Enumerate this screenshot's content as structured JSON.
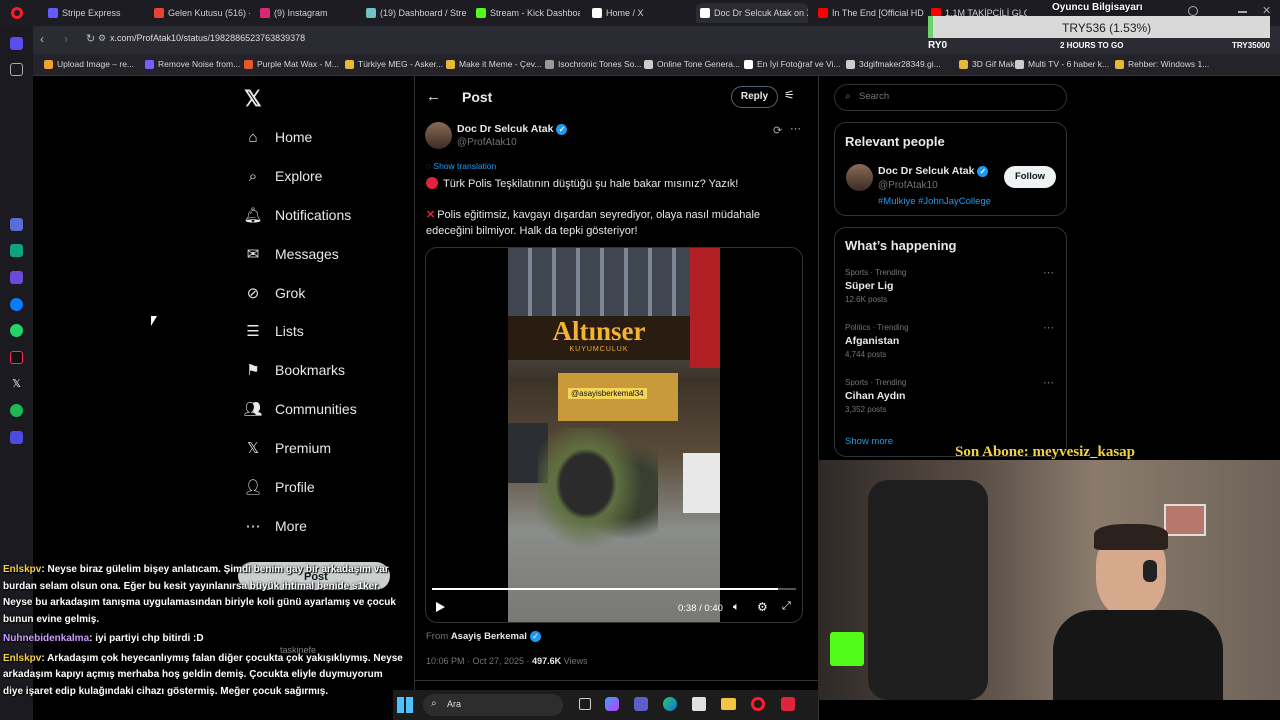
{
  "tabs": [
    {
      "label": "Stripe Express",
      "color": "#635bff"
    },
    {
      "label": "Gelen Kutusu (516) - no",
      "color": "#ea4335"
    },
    {
      "label": "(9) Instagram",
      "color": "#d62976"
    },
    {
      "label": "(19) Dashboard / Stream",
      "color": "#6fc3c3"
    },
    {
      "label": "Stream - Kick Dashboar",
      "color": "#53fc18"
    },
    {
      "label": "Home / X",
      "color": "#ffffff"
    },
    {
      "label": "Doc Dr Selcuk Atak on X:",
      "color": "#ffffff"
    },
    {
      "label": "In The End [Official HD",
      "color": "#ff0000"
    },
    {
      "label": "1.1M TAKİPÇİLİ GLOBAL",
      "color": "#ff0000"
    }
  ],
  "browser": {
    "url": "x.com/ProfAtak10/status/1982886523763839378"
  },
  "bookmarks": [
    {
      "label": "Upload Image – re...",
      "color": "#f0a030"
    },
    {
      "label": "Remove Noise from...",
      "color": "#7b5cff"
    },
    {
      "label": "Purple Mat Wax - M...",
      "color": "#e8562b"
    },
    {
      "label": "Türkiye MEG - Asker...",
      "color": "#e7b83a"
    },
    {
      "label": "Make it Meme - Çev...",
      "color": "#e7b83a"
    },
    {
      "label": "Isochronic Tones So...",
      "color": "#999999"
    },
    {
      "label": "Online Tone Genera...",
      "color": "#cccccc"
    },
    {
      "label": "En İyi Fotoğraf ve Vi...",
      "color": "#ffffff"
    },
    {
      "label": "3dgifmaker28349.gi...",
      "color": "#cccccc"
    },
    {
      "label": "3D Gif Maker",
      "color": "#e7b83a"
    },
    {
      "label": "Multi TV - 6 haber k...",
      "color": "#cccccc"
    },
    {
      "label": "Rehber: Windows 1...",
      "color": "#e7b83a"
    }
  ],
  "nav": {
    "home": "Home",
    "explore": "Explore",
    "notifications": "Notifications",
    "messages": "Messages",
    "grok": "Grok",
    "lists": "Lists",
    "bookmarks": "Bookmarks",
    "communities": "Communities",
    "premium": "Premium",
    "profile": "Profile",
    "more": "More",
    "post_button": "Post"
  },
  "post": {
    "header": "Post",
    "reply_label": "Reply",
    "author": "Doc Dr Selcuk Atak",
    "handle": "@ProfAtak10",
    "show_translation": "Show translation",
    "line1": "Türk Polis Teşkilatının düştüğü şu hale bakar mısınız? Yazık!",
    "line2": "Polis eğitimsiz, kavgayı dışardan seyrediyor, olaya nasıl müdahale edeceğini bilmiyor. Halk da tepki gösteriyor!",
    "video_time": "0:38 / 0:40",
    "video_progress": 0.95,
    "sign_text": "Altınser",
    "sign_sub": "KUYUMCULUK",
    "banner": "@asayisberkemal34",
    "from_label": "From",
    "from_name": "Asayiş Berkemal",
    "timestamp": "10:06 PM · Oct 27, 2025 ·",
    "views": "497.6K",
    "views_label": "Views"
  },
  "search": {
    "placeholder": "Search"
  },
  "relevant": {
    "title": "Relevant people",
    "name": "Doc Dr Selcuk Atak",
    "handle": "@ProfAtak10",
    "bio": "#Mulkiye #JohnJayCollege",
    "follow": "Follow"
  },
  "happening": {
    "title": "What’s happening",
    "items": [
      {
        "meta": "Sports · Trending",
        "topic": "Süper Lig",
        "posts": "12.6K posts"
      },
      {
        "meta": "Politics · Trending",
        "topic": "Afganistan",
        "posts": "4,744 posts"
      },
      {
        "meta": "Sports · Trending",
        "topic": "Cihan Aydın",
        "posts": "3,352 posts"
      }
    ],
    "show_more": "Show more"
  },
  "stream": {
    "goal_title": "Oyuncu Bilgisayarı",
    "goal_amount": "TRY536 (1.53%)",
    "goal_left": "RY0",
    "goal_sub": "2 HOURS TO GO",
    "goal_right": "TRY35000",
    "last_sub": "Son Abone: meyvesiz_kasap"
  },
  "chat": [
    {
      "user": "Enlskpv",
      "text": ": Neyse biraz gülelim bişey anlatıcam. Şimdi benim gay bir arkadaşım var burdan selam olsun ona. Eğer bu kesit yayınlanırsa büyük ihtimal benide s1ker. Neyse bu arkadaşım tanışma uygulamasından biriyle koli günü ayarlamış ve çocuk bunun evine gelmiş."
    },
    {
      "user": "Nuhnebidenkalma",
      "text": ": iyi partiyi chp bitirdi :D"
    },
    {
      "user": "Enlskpv",
      "text": ": Arkadaşım çok heyecanlıymış falan diğer çocukta çok yakışıklıymış. Neyse arkadaşım kapıyı açmış merhaba hoş geldin demiş. Çocukta eliyle duymuyorum diye işaret edip kulağındaki cihazı göstermiş. Meğer çocuk sağırmış."
    }
  ],
  "chat_ghost": "taskinefe",
  "taskbar": {
    "search": "Ara"
  }
}
